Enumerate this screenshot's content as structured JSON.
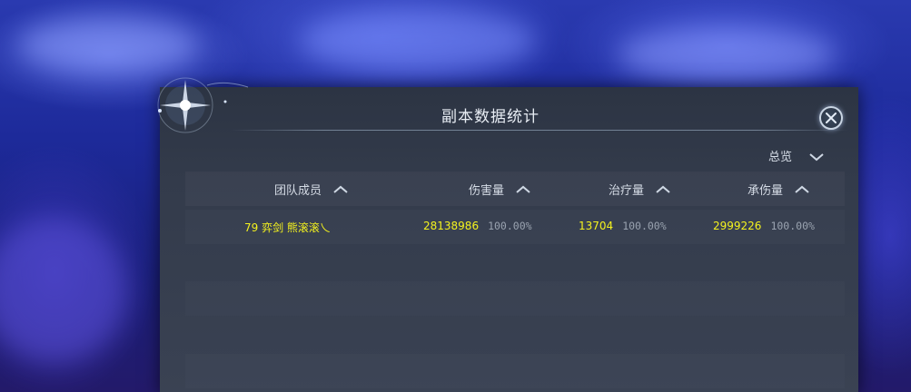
{
  "window": {
    "title": "副本数据统计",
    "close_icon": "close-icon",
    "filter_label": "总览"
  },
  "table": {
    "columns": [
      {
        "label": "团队成员"
      },
      {
        "label": "伤害量"
      },
      {
        "label": "治疗量"
      },
      {
        "label": "承伤量"
      }
    ],
    "rows": [
      {
        "member": "79 弈剑 熊滚滚乀",
        "damage": "28138986",
        "damage_pct": "100.00%",
        "healing": "13704",
        "healing_pct": "100.00%",
        "taken": "2999226",
        "taken_pct": "100.00%"
      }
    ]
  },
  "colors": {
    "highlight_text": "#f4f21e",
    "panel_bg": "#333b4b",
    "background": "#1d2a9a"
  }
}
